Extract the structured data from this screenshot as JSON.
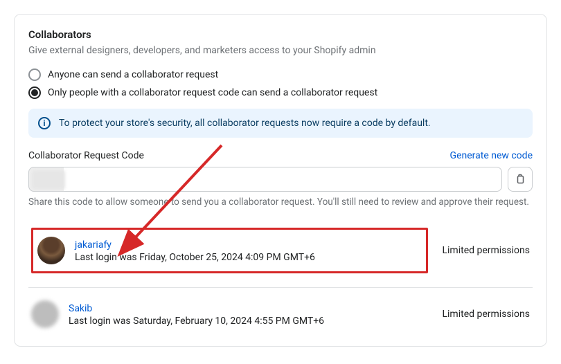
{
  "section": {
    "title": "Collaborators",
    "subtitle": "Give external designers, developers, and marketers access to your Shopify admin"
  },
  "radios": {
    "anyone": "Anyone can send a collaborator request",
    "code_only": "Only people with a collaborator request code can send a collaborator request"
  },
  "banner": {
    "text": "To protect your store's security, all collaborator requests now require a code by default."
  },
  "code": {
    "label": "Collaborator Request Code",
    "generate_link": "Generate new code",
    "helper": "Share this code to allow someone to send you a collaborator request. You'll still need to review and approve their request."
  },
  "collaborators": [
    {
      "name": "jakariafy",
      "last_login": "Last login was Friday, October 25, 2024 4:09 PM GMT+6",
      "permission": "Limited permissions"
    },
    {
      "name": "Sakib",
      "last_login": "Last login was Saturday, February 10, 2024 4:55 PM GMT+6",
      "permission": "Limited permissions"
    }
  ]
}
